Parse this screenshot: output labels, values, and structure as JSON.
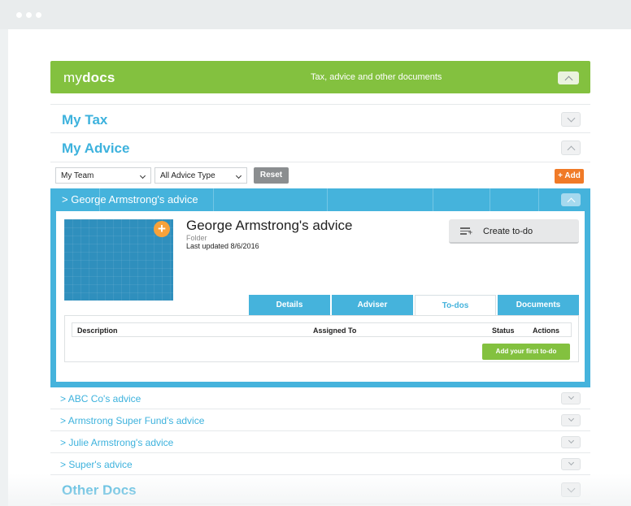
{
  "brand": {
    "logo_light": "my",
    "logo_bold": "docs",
    "subtitle": "Tax, advice and other documents"
  },
  "sections": {
    "my_tax": "My Tax",
    "my_advice": "My Advice",
    "other_docs": "Other Docs"
  },
  "filters": {
    "team": "My Team",
    "advice_type": "All Advice Type",
    "reset": "Reset",
    "add": "+ Add"
  },
  "expanded_advice": {
    "header": "George Armstrong's advice",
    "title": "George Armstrong's advice",
    "type": "Folder",
    "updated": "Last updated 8/6/2016",
    "create_todo": "Create to-do",
    "tabs": [
      "Details",
      "Adviser",
      "To-dos",
      "Documents"
    ],
    "active_tab": "To-dos",
    "todo_columns": {
      "description": "Description",
      "assigned": "Assigned To",
      "status": "Status",
      "actions": "Actions"
    },
    "add_first_todo": "Add your first to-do"
  },
  "advice_items": [
    "ABC Co's advice",
    "Armstrong Super Fund's advice",
    "Julie Armstrong's advice",
    "Super's advice"
  ],
  "colors": {
    "green": "#83c13f",
    "blue": "#45b3dc",
    "orange": "#f07a27",
    "title_blue": "#3db2dd"
  }
}
